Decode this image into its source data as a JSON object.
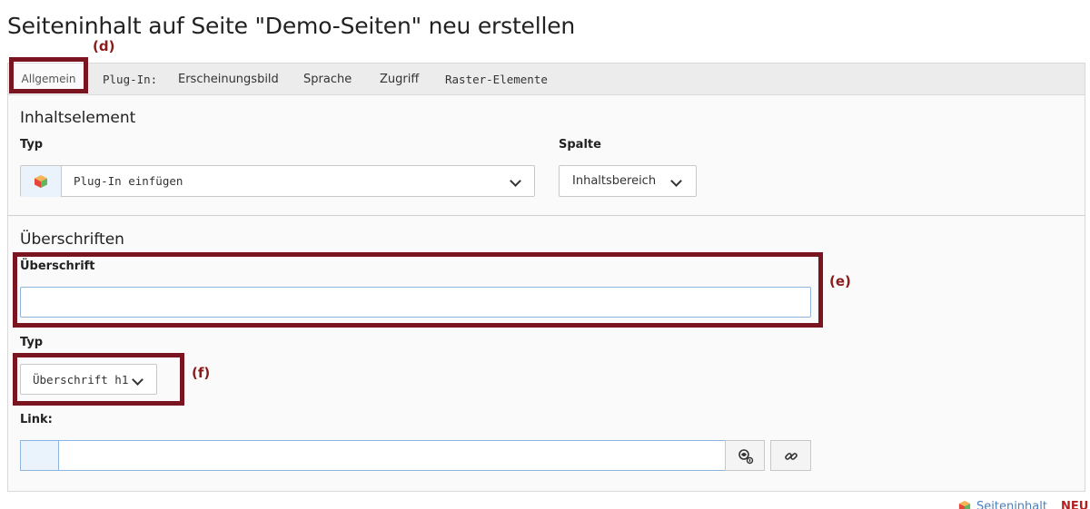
{
  "page": {
    "title": "Seiteninhalt auf Seite \"Demo-Seiten\" neu erstellen"
  },
  "annotations": {
    "d": "(d)",
    "e": "(e)",
    "f": "(f)"
  },
  "tabs": [
    {
      "label": "Allgemein",
      "active": true
    },
    {
      "label": "Plug-In:"
    },
    {
      "label": "Erscheinungsbild"
    },
    {
      "label": "Sprache"
    },
    {
      "label": "Zugriff"
    },
    {
      "label": "Raster-Elemente"
    }
  ],
  "content_element": {
    "section_title": "Inhaltselement",
    "type_label": "Typ",
    "type_value": "Plug-In einfügen",
    "type_icon": "plugin-cube-icon",
    "column_label": "Spalte",
    "column_value": "Inhaltsbereich"
  },
  "headings": {
    "section_title": "Überschriften",
    "heading_label": "Überschrift",
    "heading_value": "",
    "type_label": "Typ",
    "type_value": "Überschrift h1",
    "link_label": "Link:",
    "link_value": ""
  },
  "footer": {
    "record_label": "Seiteninhalt",
    "new_badge": "NEU",
    "icon": "content-cube-icon"
  },
  "colors": {
    "annotation": "#7a1420",
    "input_focus_border": "#8fb4de",
    "link": "#4a7fc1"
  }
}
